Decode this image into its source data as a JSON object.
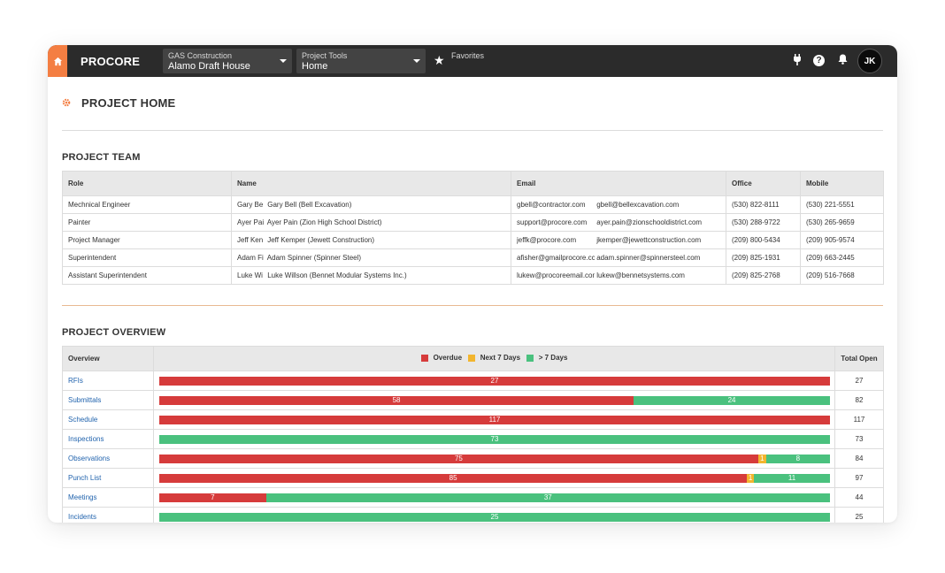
{
  "colors": {
    "brand": "#f47e42",
    "overdue": "#d63b3b",
    "next7": "#f2b52e",
    "gt7": "#4ac17e",
    "link": "#2264ae"
  },
  "topbar": {
    "logo": "PROCORE",
    "company": {
      "label": "GAS Construction",
      "value": "Alamo Draft House"
    },
    "tools": {
      "label": "Project Tools",
      "value": "Home"
    },
    "favorites_label": "Favorites",
    "avatar_initials": "JK"
  },
  "page": {
    "title": "PROJECT HOME"
  },
  "team": {
    "title": "PROJECT TEAM",
    "headers": [
      "Role",
      "Name",
      "Email",
      "Office",
      "Mobile"
    ],
    "rows": [
      {
        "role": "Mechnical Engineer",
        "short": "Gary Be",
        "name": "Gary Bell (Bell Excavation)",
        "email1": "gbell@contractor.com",
        "email2": "gbell@bellexcavation.com",
        "office": "(530) 822-8111",
        "mobile": "(530) 221-5551"
      },
      {
        "role": "Painter",
        "short": "Ayer Pai",
        "name": "Ayer Pain (Zion High School District)",
        "email1": "support@procore.com",
        "email2": "ayer.pain@zionschooldistrict.com",
        "office": "(530) 288-9722",
        "mobile": "(530) 265-9659"
      },
      {
        "role": "Project Manager",
        "short": "Jeff Ken",
        "name": "Jeff Kemper (Jewett Construction)",
        "email1": "jeffk@procore.com",
        "email2": "jkemper@jewettconstruction.com",
        "office": "(209) 800-5434",
        "mobile": "(209) 905-9574"
      },
      {
        "role": "Superintendent",
        "short": "Adam Fi",
        "name": "Adam Spinner (Spinner Steel)",
        "email1": "afisher@gmailprocore.cc",
        "email2": "adam.spinner@spinnersteel.com",
        "office": "(209) 825-1931",
        "mobile": "(209) 663-2445"
      },
      {
        "role": "Assistant Superintendent",
        "short": "Luke Wi",
        "name": "Luke Willson (Bennet Modular Systems Inc.)",
        "email1": "lukew@procoreemail.com",
        "email2": "lukew@bennetsystems.com",
        "office": "(209) 825-2768",
        "mobile": "(209) 516-7668"
      }
    ]
  },
  "overview": {
    "title": "PROJECT OVERVIEW",
    "headers": {
      "overview": "Overview",
      "total": "Total Open"
    },
    "legend": {
      "overdue": "Overdue",
      "next7": "Next 7 Days",
      "gt7": "> 7 Days"
    },
    "rows": [
      {
        "label": "RFIs",
        "overdue": 27,
        "next7": 0,
        "gt7": 0,
        "total": "27"
      },
      {
        "label": "Submittals",
        "overdue": 58,
        "next7": 0,
        "gt7": 24,
        "total": "82"
      },
      {
        "label": "Schedule",
        "overdue": 117,
        "next7": 0,
        "gt7": 0,
        "total": "117"
      },
      {
        "label": "Inspections",
        "overdue": 0,
        "next7": 0,
        "gt7": 73,
        "total": "73"
      },
      {
        "label": "Observations",
        "overdue": 75,
        "next7": 1,
        "gt7": 8,
        "total": "84"
      },
      {
        "label": "Punch List",
        "overdue": 85,
        "next7": 1,
        "gt7": 11,
        "total": "97"
      },
      {
        "label": "Meetings",
        "overdue": 7,
        "next7": 0,
        "gt7": 37,
        "total": "44"
      },
      {
        "label": "Incidents",
        "overdue": 0,
        "next7": 0,
        "gt7": 25,
        "total": "25"
      }
    ]
  }
}
